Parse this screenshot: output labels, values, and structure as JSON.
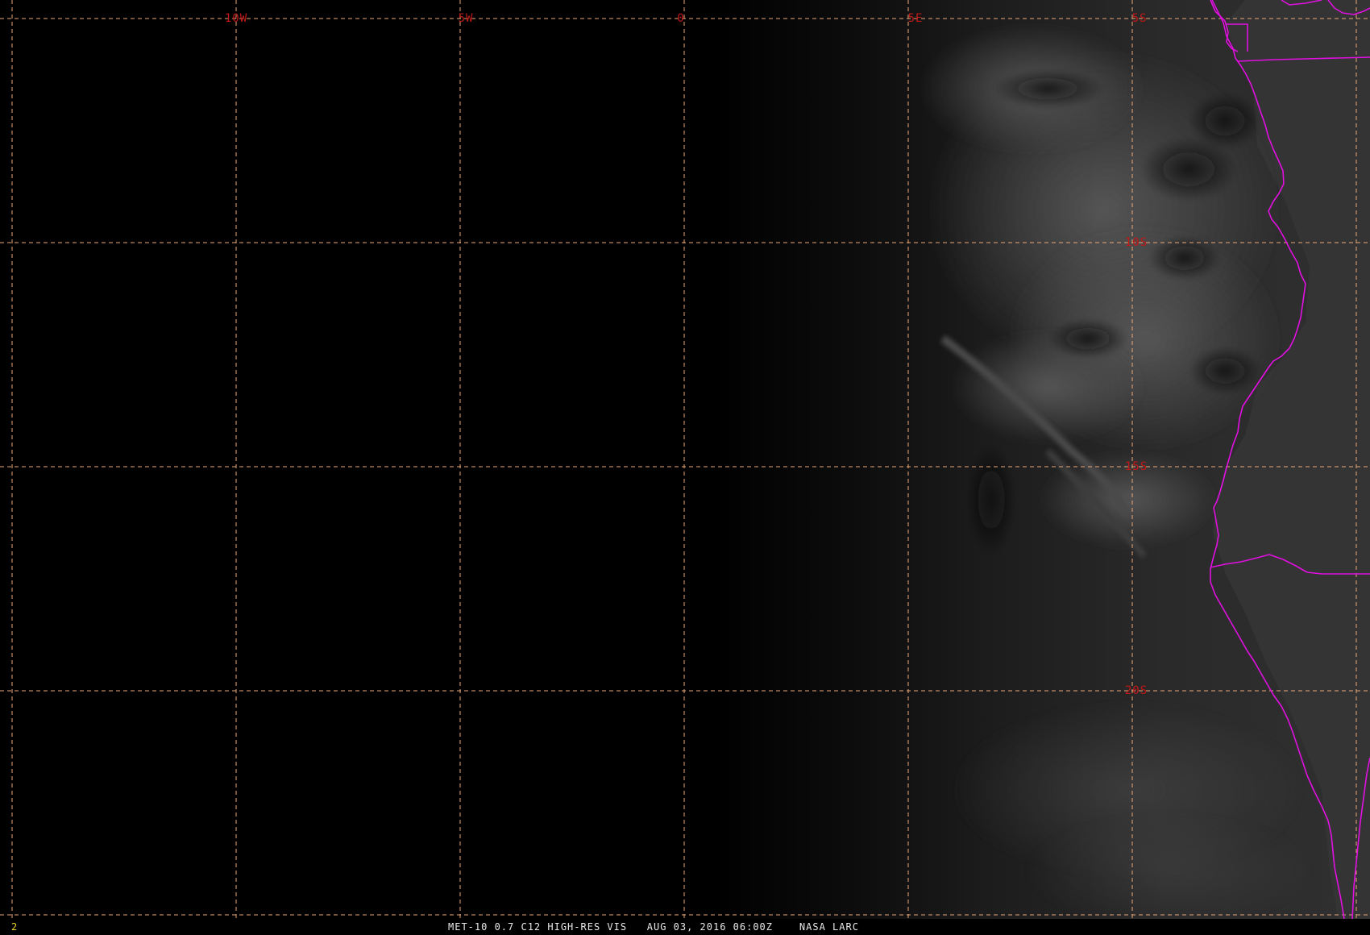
{
  "map": {
    "frame_number": "2",
    "caption": "MET-10 0.7 C12 HIGH-RES VIS   AUG 03, 2016 06:00Z    NASA LARC",
    "longitude_labels": [
      "10W",
      "5W",
      "0",
      "5E",
      "5S"
    ],
    "latitude_labels": [
      "10S",
      "15S",
      "20S"
    ],
    "colors": {
      "grid": "#e8a878",
      "grid_label": "#c01818",
      "political_border": "#e010e0",
      "frame_number": "#e8d020",
      "caption": "#e8e8e8",
      "background": "#000000"
    }
  }
}
